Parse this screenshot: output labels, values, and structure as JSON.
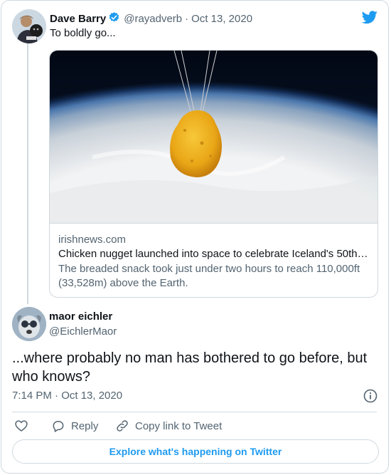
{
  "tweet": {
    "author_name": "Dave Barry",
    "handle": "@rayadverb",
    "separator": "·",
    "date": "Oct 13, 2020",
    "text": "To boldly go...",
    "link_card": {
      "domain": "irishnews.com",
      "headline": "Chicken nugget launched into space to celebrate Iceland's 50th…",
      "description": "The breaded snack took just under two hours to reach 110,000ft (33,528m) above the Earth."
    }
  },
  "reply": {
    "author_name": "maor eichler",
    "handle": "@EichlerMaor",
    "text": "...where probably no man has bothered to go before, but who knows?",
    "timestamp": "7:14 PM · Oct 13, 2020"
  },
  "actions": {
    "reply_label": "Reply",
    "copy_link_label": "Copy link to Tweet"
  },
  "explore_label": "Explore what's happening on Twitter",
  "icons": {
    "verified": "verified-badge-icon",
    "twitter": "twitter-bird-icon",
    "info": "info-icon",
    "like": "heart-icon",
    "reply": "speech-bubble-icon",
    "copy": "link-icon"
  },
  "colors": {
    "accent": "#1d9bf0",
    "text": "#0f1419",
    "muted": "#536471",
    "border": "#cfd9de"
  }
}
